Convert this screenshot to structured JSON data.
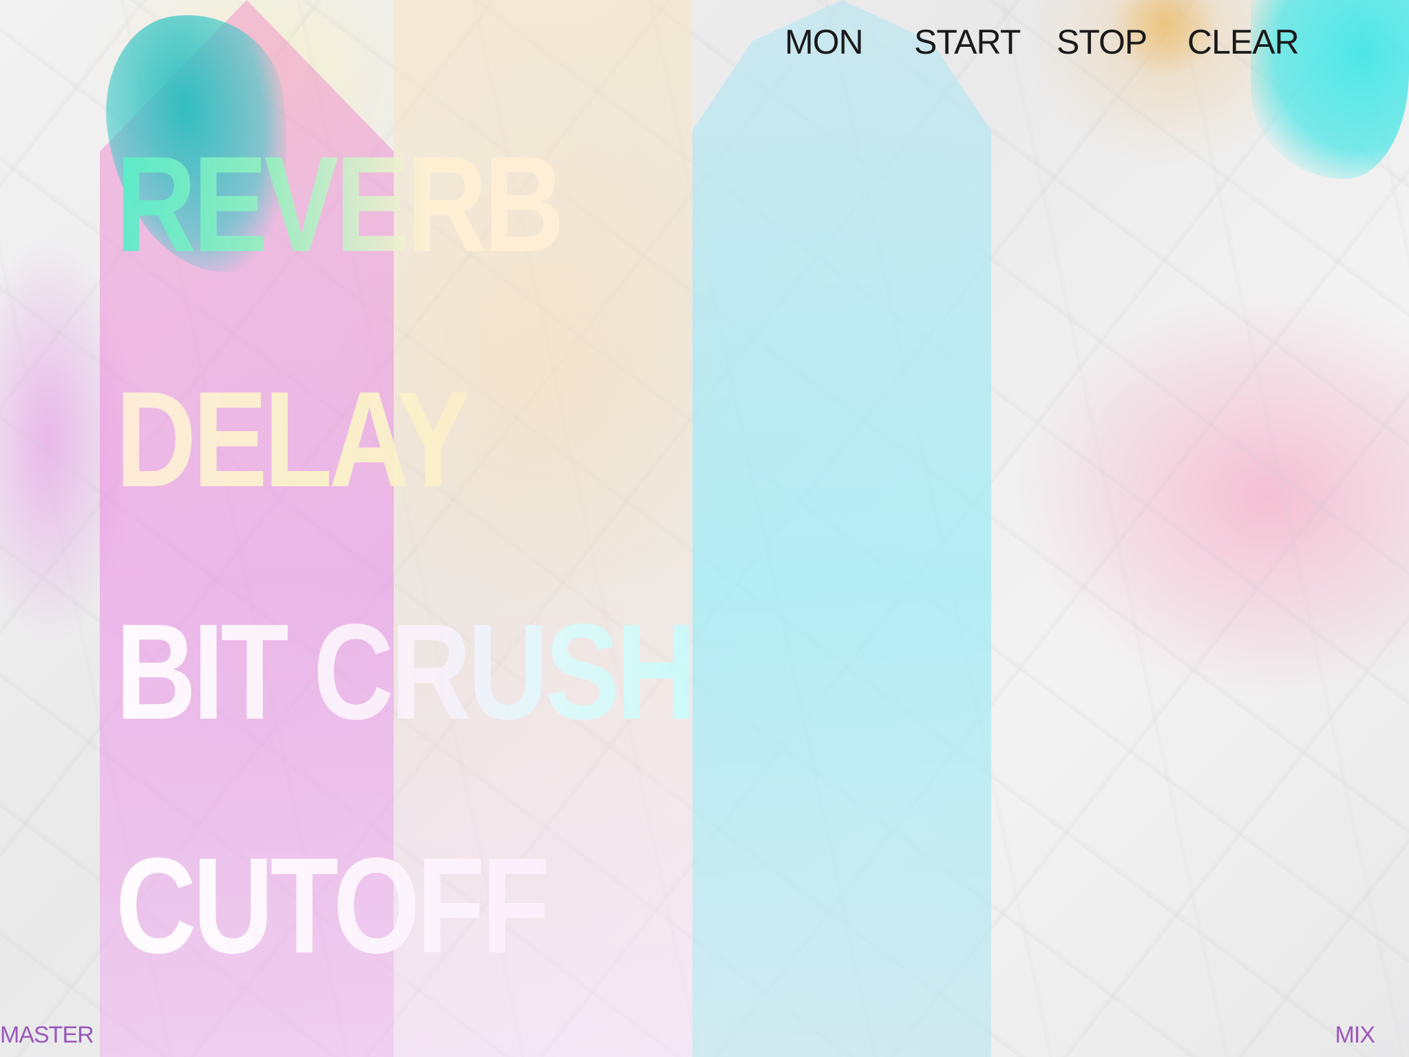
{
  "top_menu": {
    "mon": "MON",
    "start": "START",
    "stop": "STOP",
    "clear": "CLEAR"
  },
  "effects": {
    "reverb": "REVERB",
    "delay": "DELAY",
    "bit_crush": "BIT CRUSH",
    "cutoff": "CUTOFF"
  },
  "bottom": {
    "master": "MASTER",
    "mix": "MIX"
  },
  "colors": {
    "text_dark": "#1a1a1a",
    "bottom_label": "#9a58b8",
    "pink_column": "#eb8ce6",
    "blue_column": "#a0ebf5",
    "teal_splash": "#28bebe",
    "cyan_splash": "#46e6e6"
  }
}
